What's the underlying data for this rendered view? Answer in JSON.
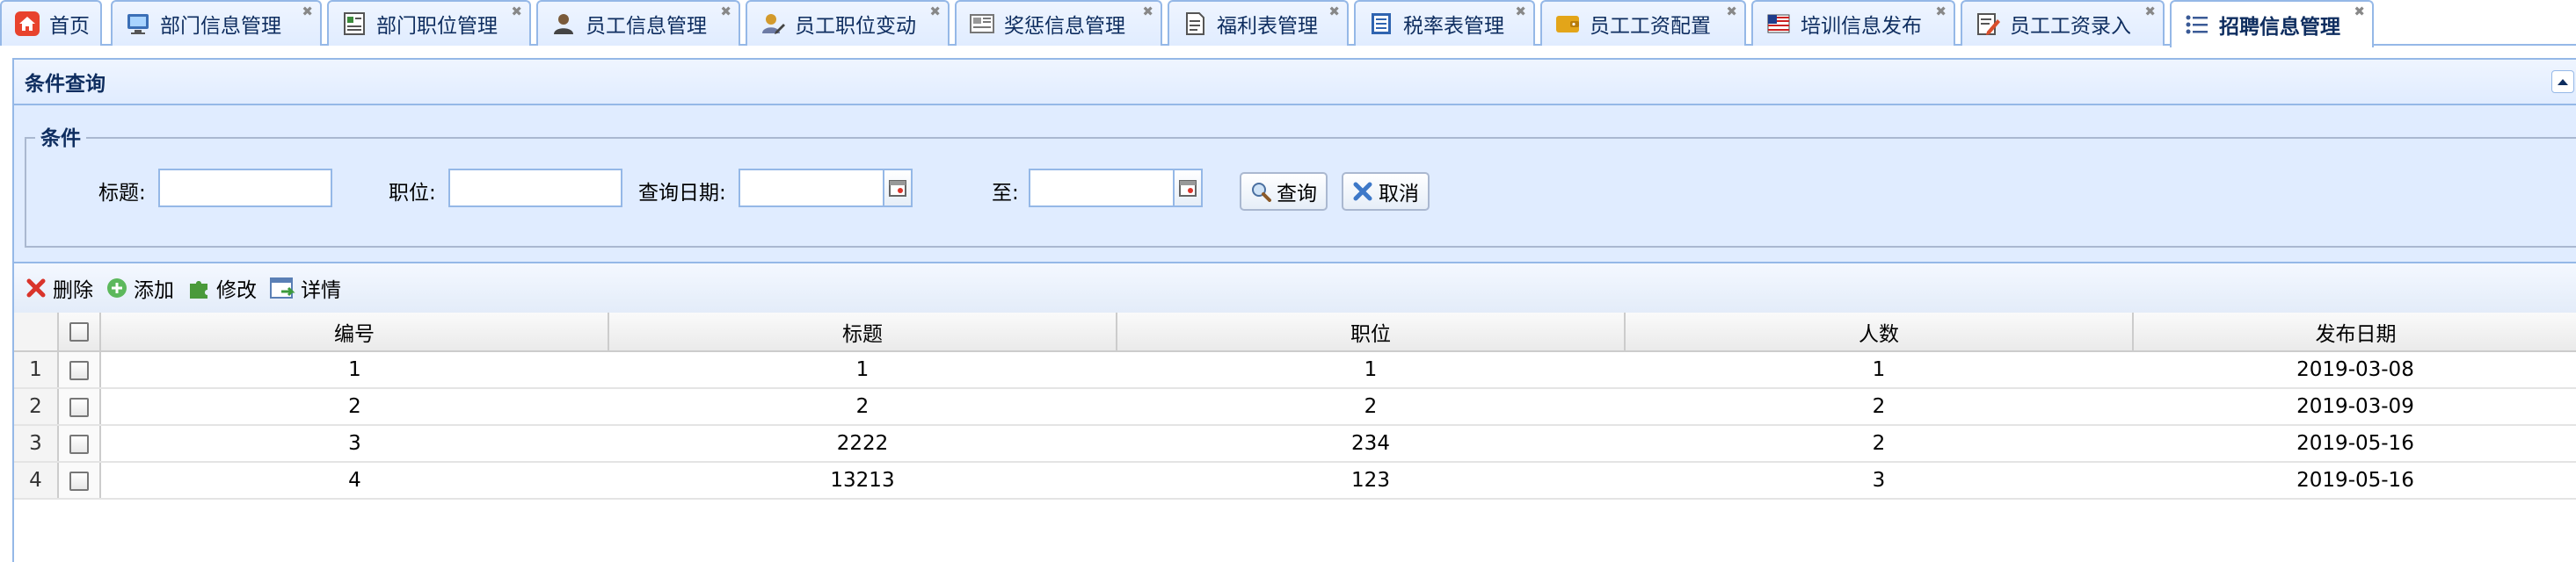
{
  "tabs": [
    {
      "label": "首页",
      "icon": "home-icon",
      "closable": false
    },
    {
      "label": "部门信息管理",
      "icon": "monitor-icon",
      "closable": true
    },
    {
      "label": "部门职位管理",
      "icon": "id-card-icon",
      "closable": true
    },
    {
      "label": "员工信息管理",
      "icon": "user-icon",
      "closable": true
    },
    {
      "label": "员工职位变动",
      "icon": "users-edit-icon",
      "closable": true
    },
    {
      "label": "奖惩信息管理",
      "icon": "news-icon",
      "closable": true
    },
    {
      "label": "福利表管理",
      "icon": "document-icon",
      "closable": true
    },
    {
      "label": "税率表管理",
      "icon": "sheet-icon",
      "closable": true
    },
    {
      "label": "员工工资配置",
      "icon": "wallet-icon",
      "closable": true
    },
    {
      "label": "培训信息发布",
      "icon": "flag-icon",
      "closable": true
    },
    {
      "label": "员工工资录入",
      "icon": "edit-icon",
      "closable": true
    },
    {
      "label": "招聘信息管理",
      "icon": "list-icon",
      "closable": true,
      "active": true
    }
  ],
  "search_panel": {
    "title": "条件查询",
    "legend": "条件",
    "title_label": "标题:",
    "position_label": "职位:",
    "date_label": "查询日期:",
    "to_label": "至:",
    "query_button": "查询",
    "cancel_button": "取消"
  },
  "toolbar": {
    "delete": "删除",
    "add": "添加",
    "edit": "修改",
    "detail": "详情"
  },
  "grid": {
    "columns": [
      "编号",
      "标题",
      "职位",
      "人数",
      "发布日期"
    ],
    "rows": [
      {
        "rownum": "1",
        "id": "1",
        "title": "1",
        "position": "1",
        "count": "1",
        "date": "2019-03-08"
      },
      {
        "rownum": "2",
        "id": "2",
        "title": "2",
        "position": "2",
        "count": "2",
        "date": "2019-03-09"
      },
      {
        "rownum": "3",
        "id": "3",
        "title": "2222",
        "position": "234",
        "count": "2",
        "date": "2019-05-16"
      },
      {
        "rownum": "4",
        "id": "4",
        "title": "13213",
        "position": "123",
        "count": "3",
        "date": "2019-05-16"
      }
    ]
  }
}
